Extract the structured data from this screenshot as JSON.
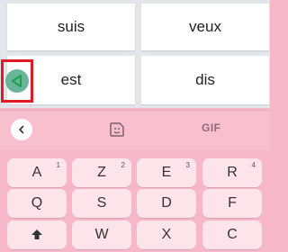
{
  "words": [
    "suis",
    "veux",
    "est",
    "dis"
  ],
  "icons": {
    "back_arrow": "left-triangle-icon",
    "toolbar_back": "chevron-left-icon",
    "sticker": "sticker-smile-icon",
    "shift": "shift-up-arrow-icon"
  },
  "toolbar": {
    "gif_label": "GIF"
  },
  "keyboard": {
    "row1": [
      {
        "label": "A",
        "hint": "1"
      },
      {
        "label": "Z",
        "hint": "2"
      },
      {
        "label": "E",
        "hint": "3"
      },
      {
        "label": "R",
        "hint": "4"
      }
    ],
    "row2": [
      "Q",
      "S",
      "D",
      "F"
    ],
    "row3": [
      "W",
      "X",
      "C"
    ]
  },
  "colors": {
    "word_area_bg": "#e2e5ea",
    "keyboard_bg": "#f6b8c8",
    "key_bg": "#fde3ea",
    "highlight_border": "#e01b24",
    "back_button": "#6ab59a"
  }
}
